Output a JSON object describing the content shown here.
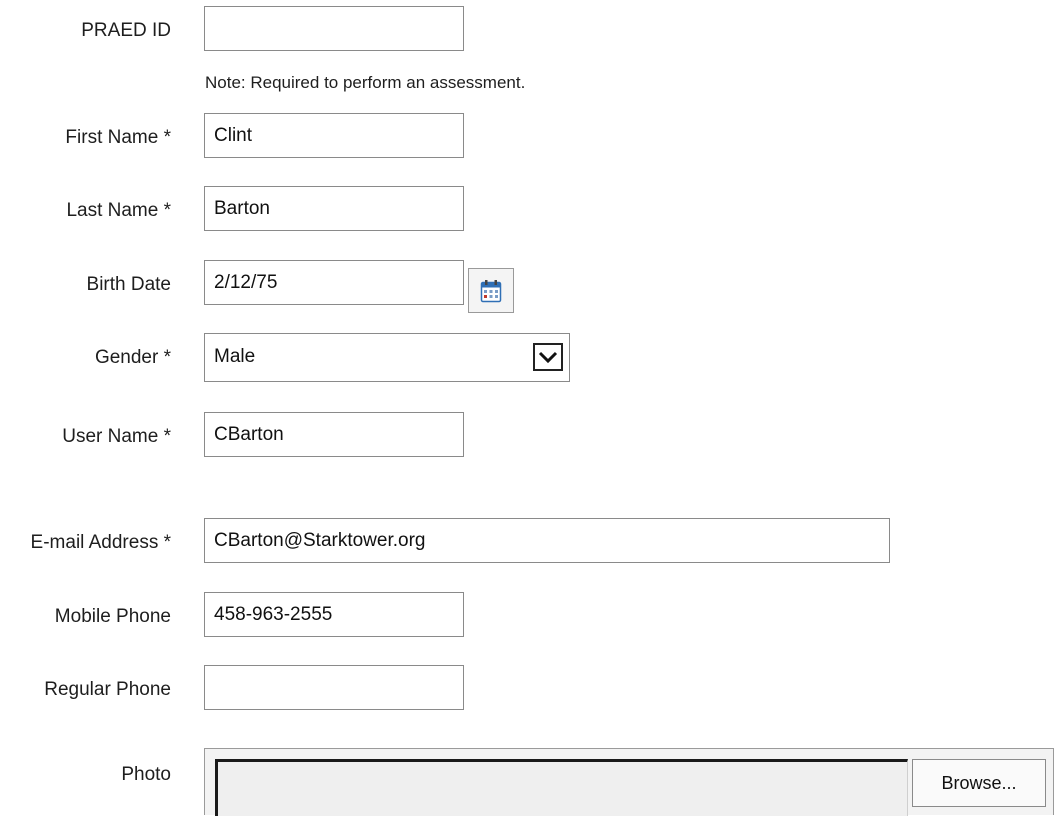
{
  "praed_id": {
    "label": "PRAED ID",
    "value": "",
    "note": "Note: Required to perform an assessment."
  },
  "first_name": {
    "label": "First Name *",
    "value": "Clint"
  },
  "last_name": {
    "label": "Last Name *",
    "value": "Barton"
  },
  "birth_date": {
    "label": "Birth Date",
    "value": "2/12/75",
    "icon": "calendar-icon"
  },
  "gender": {
    "label": "Gender *",
    "value": "Male",
    "icon": "chevron-down-icon"
  },
  "user_name": {
    "label": "User Name *",
    "value": "CBarton"
  },
  "email": {
    "label": "E-mail Address *",
    "value": "CBarton@Starktower.org"
  },
  "mobile_phone": {
    "label": "Mobile Phone",
    "value": "458-963-2555"
  },
  "regular_phone": {
    "label": "Regular Phone",
    "value": ""
  },
  "photo": {
    "label": "Photo",
    "path": "",
    "browse_label": "Browse..."
  },
  "colors": {
    "border": "#8a8a8a",
    "text": "#1e1e1e",
    "calendar_blue": "#2f6fb5",
    "calendar_red": "#c0392b"
  }
}
